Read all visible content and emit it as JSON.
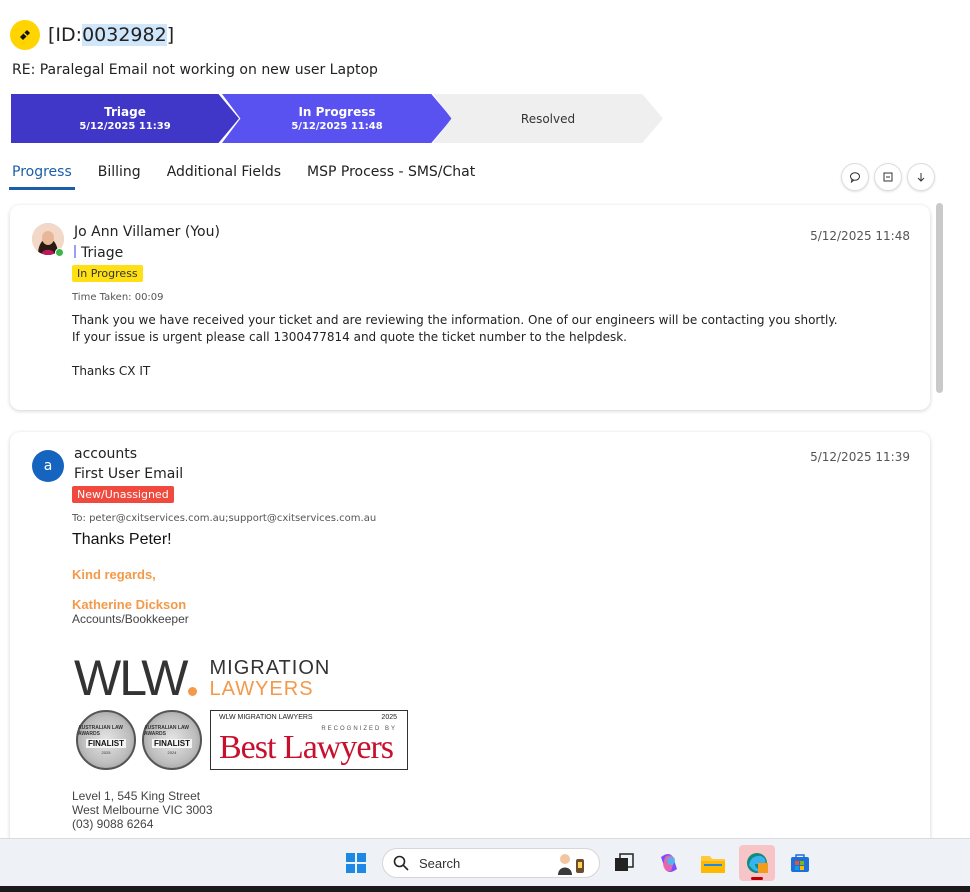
{
  "header": {
    "id_prefix": "[ID:",
    "id_number": "0032982",
    "id_suffix": "]",
    "subject": "RE: Paralegal Email not working on new user Laptop"
  },
  "stepper": [
    {
      "label": "Triage",
      "date": "5/12/2025 11:39"
    },
    {
      "label": "In Progress",
      "date": "5/12/2025 11:48"
    },
    {
      "label": "Resolved",
      "date": ""
    }
  ],
  "tabs": [
    "Progress",
    "Billing",
    "Additional Fields",
    "MSP Process - SMS/Chat"
  ],
  "colors": {
    "step_done": "#4037c9",
    "step_current": "#5a52f0",
    "tab_active": "#1a5fa8",
    "badge_in_progress": "#ffe014",
    "badge_new": "#f04a3e",
    "signature_orange": "#f39a4a"
  },
  "icons": {
    "ticket": "ticket-icon",
    "actions": [
      "chat-bubble-icon",
      "collapse-icon",
      "download-arrow-icon"
    ]
  },
  "entries": [
    {
      "author": "Jo Ann Villamer (You)",
      "timestamp": "5/12/2025 11:48",
      "stage": "Triage",
      "status": "In Progress",
      "meta": "Time Taken: 00:09",
      "lines": [
        "Thank you we have received your ticket and are reviewing the information. One of our engineers will be contacting you shortly.",
        "If your issue is urgent please call 1300477814 and quote the ticket number to the helpdesk.",
        "Thanks CX IT"
      ]
    },
    {
      "author": "accounts",
      "avatar_letter": "a",
      "timestamp": "5/12/2025 11:39",
      "stage": "First User Email",
      "status": "New/Unassigned",
      "meta": "To: peter@cxitservices.com.au;support@cxitservices.com.au",
      "greeting": "Thanks Peter!",
      "regards": "Kind regards,",
      "sig_name": "Katherine Dickson",
      "sig_role": "Accounts/Bookkeeper",
      "logo": {
        "main": "WLW",
        "word1": "MIGRATION",
        "word2": "LAWYERS"
      },
      "medals": [
        {
          "top": "AUSTRALIAN LAW AWARDS",
          "mid": "FINALIST",
          "year": "2025"
        },
        {
          "top": "AUSTRALIAN LAW AWARDS",
          "mid": "FINALIST",
          "year": "2024"
        }
      ],
      "best_lawyers": {
        "firm": "WLW MIGRATION LAWYERS",
        "year": "2025",
        "recognized": "RECOGNIZED BY",
        "name": "Best Lawyers"
      },
      "address": [
        "Level 1, 545 King Street",
        "West Melbourne  VIC  3003",
        "(03) 9088 6264"
      ]
    }
  ],
  "taskbar": {
    "search_placeholder": "Search"
  }
}
